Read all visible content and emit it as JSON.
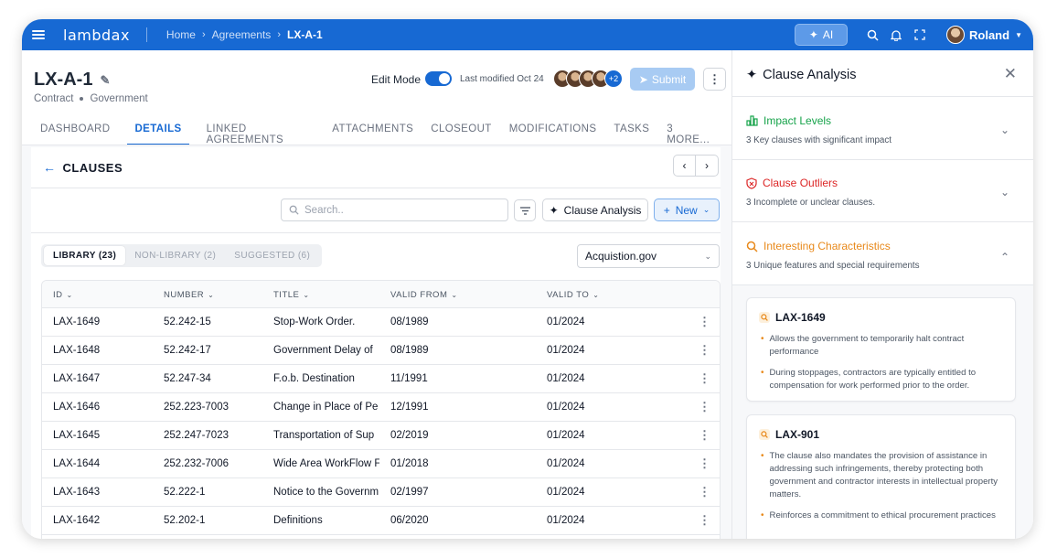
{
  "topbar": {
    "logo": "lambdax",
    "breadcrumbs": [
      "Home",
      "Agreements",
      "LX-A-1"
    ],
    "ai_label": "AI",
    "user_name": "Roland"
  },
  "header": {
    "title": "LX-A-1",
    "type": "Contract",
    "category": "Government",
    "edit_mode_label": "Edit Mode",
    "edit_mode_on": true,
    "last_modified": "Last modified Oct 24",
    "collaborators_extra": "+2",
    "submit_label": "Submit"
  },
  "tabs": [
    "DASHBOARD",
    "DETAILS",
    "LINKED AGREEMENTS",
    "ATTACHMENTS",
    "CLOSEOUT",
    "MODIFICATIONS",
    "TASKS",
    "3 MORE..."
  ],
  "active_tab": "DETAILS",
  "clauses": {
    "heading": "CLAUSES",
    "search_placeholder": "Search..",
    "clause_analysis_label": "Clause Analysis",
    "new_label": "New",
    "segments": [
      "LIBRARY (23)",
      "NON-LIBRARY (2)",
      "SUGGESTED (6)"
    ],
    "source": "Acquistion.gov",
    "columns": [
      "ID",
      "NUMBER",
      "TITLE",
      "VALID FROM",
      "VALID TO"
    ],
    "rows": [
      {
        "id": "LAX-1649",
        "number": "52.242-15",
        "title": "Stop-Work Order.",
        "from": "08/1989",
        "to": "01/2024"
      },
      {
        "id": "LAX-1648",
        "number": "52.242-17",
        "title": "Government Delay of",
        "from": "08/1989",
        "to": "01/2024"
      },
      {
        "id": "LAX-1647",
        "number": "52.247-34",
        "title": "F.o.b. Destination",
        "from": "11/1991",
        "to": "01/2024"
      },
      {
        "id": "LAX-1646",
        "number": "252.223-7003",
        "title": "Change in Place of Pe",
        "from": "12/1991",
        "to": "01/2024"
      },
      {
        "id": "LAX-1645",
        "number": "252.247-7023",
        "title": "Transportation of Sup",
        "from": "02/2019",
        "to": "01/2024"
      },
      {
        "id": "LAX-1644",
        "number": "252.232-7006",
        "title": "Wide Area WorkFlow F",
        "from": "01/2018",
        "to": "01/2024"
      },
      {
        "id": "LAX-1643",
        "number": "52.222-1",
        "title": "Notice to the Governm",
        "from": "02/1997",
        "to": "01/2024"
      },
      {
        "id": "LAX-1642",
        "number": "52.202-1",
        "title": "Definitions",
        "from": "06/2020",
        "to": "01/2024"
      }
    ]
  },
  "panel": {
    "title": "Clause Analysis",
    "sections": [
      {
        "title": "Impact Levels",
        "desc": "3 Key clauses with significant impact",
        "color": "#16a34a"
      },
      {
        "title": "Clause Outliers",
        "desc": "3 Incomplete or unclear clauses.",
        "color": "#dc2626"
      },
      {
        "title": "Interesting Characteristics",
        "desc": "3 Unique features and special requirements",
        "color": "#e8891b"
      }
    ],
    "features": [
      {
        "id": "LAX-1649",
        "bullets": [
          "Allows the government to temporarily halt contract performance",
          "During stoppages, contractors are typically entitled to compensation for work performed prior to the order."
        ]
      },
      {
        "id": "LAX-901",
        "bullets": [
          "The clause also mandates the provision of assistance in addressing such infringements, thereby protecting both government and contractor interests in intellectual property matters.",
          "Reinforces a commitment to ethical procurement practices"
        ]
      }
    ]
  },
  "colors": {
    "brand": "#1769d3",
    "impact": "#16a34a",
    "outlier": "#dc2626",
    "interesting": "#e8891b"
  },
  "icons": [
    "menu-icon",
    "sparkle-icon",
    "search-icon",
    "bell-icon",
    "fullscreen-icon",
    "pencil-icon",
    "filter-icon",
    "chevron-down-icon",
    "close-icon",
    "bar-chart-icon",
    "shield-icon",
    "magnifier-icon",
    "kebab-icon"
  ]
}
